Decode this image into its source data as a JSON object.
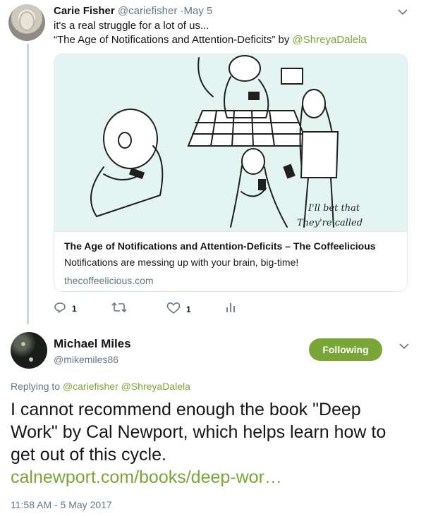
{
  "parent": {
    "name": "Carie Fisher",
    "handle": "@cariefisher",
    "time": "May 5",
    "text_line1": "it's a real struggle for a lot of us...",
    "text_line2": "“The Age of Notifications and Attention-Deficits” by",
    "text_mention": "@ShreyaDalela",
    "card": {
      "title": "The Age of Notifications and Attention-Deficits – The Coffeelicious",
      "description": "Notifications are messing up with your brain, big-time!",
      "domain": "thecoffeelicious.com",
      "image_caption_line1": "I'll bet that",
      "image_caption_line2": "They're called"
    },
    "actions": {
      "reply_count": "1",
      "like_count": "1"
    }
  },
  "reply": {
    "name": "Michael Miles",
    "handle": "@mikemiles86",
    "follow_label": "Following",
    "replying_to_label": "Replying to",
    "replying_to_users": "@cariefisher @ShreyaDalela",
    "text": "I cannot recommend enough the book \"Deep Work\" by Cal Newport, which helps learn how to get out of this cycle.",
    "link": "calnewport.com/books/deep-wor…",
    "timestamp": "11:58 AM - 5 May 2017"
  },
  "icons": {
    "reply": "reply-icon",
    "retweet": "retweet-icon",
    "like": "heart-icon",
    "analytics": "analytics-icon",
    "more": "chevron-down-icon"
  },
  "colors": {
    "accent": "#79a636",
    "muted": "#657786",
    "border": "#e1e8ed",
    "card_bg": "#e4f4f1"
  }
}
